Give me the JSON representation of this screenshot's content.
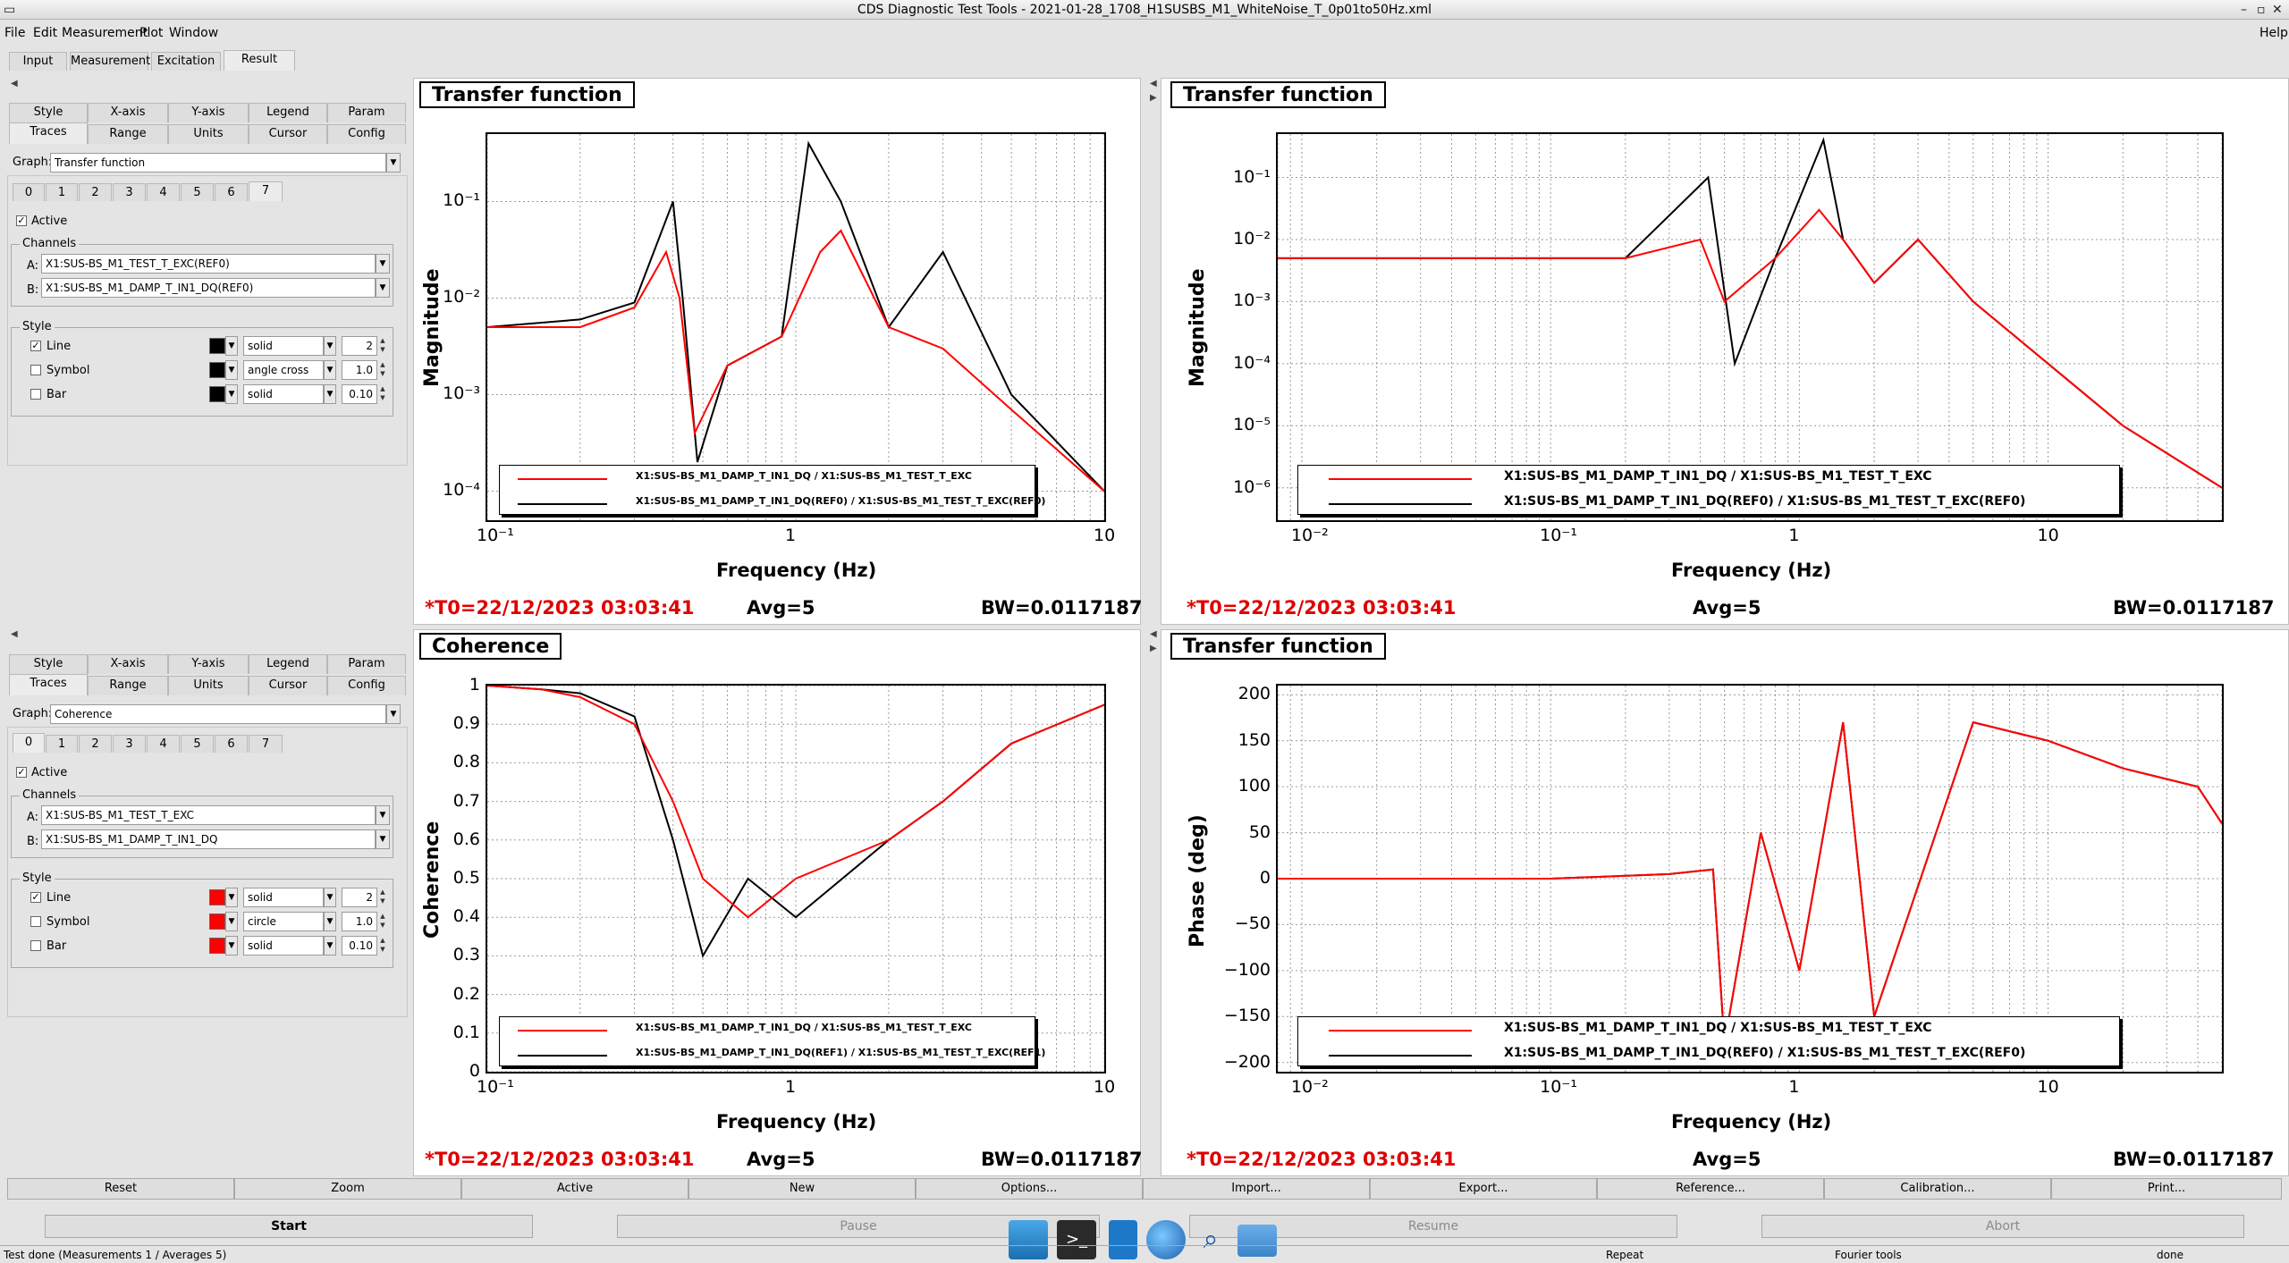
{
  "window": {
    "title": "CDS Diagnostic Test Tools - 2021-01-28_1708_H1SUSBS_M1_WhiteNoise_T_0p01to50Hz.xml"
  },
  "menu": {
    "items": [
      "File",
      "Edit",
      "Measurement",
      "Plot",
      "Window"
    ],
    "help": "Help"
  },
  "main_tabs": [
    "Input",
    "Measurement",
    "Excitation",
    "Result"
  ],
  "option_panels": [
    {
      "tabs_row1": [
        "Style",
        "X-axis",
        "Y-axis",
        "Legend",
        "Param"
      ],
      "tabs_row2": [
        "Traces",
        "Range",
        "Units",
        "Cursor",
        "Config"
      ],
      "graph_label": "Graph:",
      "graph_value": "Transfer function",
      "trace_tabs": [
        "0",
        "1",
        "2",
        "3",
        "4",
        "5",
        "6",
        "7"
      ],
      "active_label": "Active",
      "channels_title": "Channels",
      "channel_a_label": "A:",
      "channel_a": "X1:SUS-BS_M1_TEST_T_EXC(REF0)",
      "channel_b_label": "B:",
      "channel_b": "X1:SUS-BS_M1_DAMP_T_IN1_DQ(REF0)",
      "style_title": "Style",
      "line_label": "Line",
      "line_style": "solid",
      "line_width": "2",
      "symbol_label": "Symbol",
      "symbol_style": "angle cross",
      "symbol_size": "1.0",
      "bar_label": "Bar",
      "bar_style": "solid",
      "bar_width": "0.10",
      "color": "#000000"
    },
    {
      "tabs_row1": [
        "Style",
        "X-axis",
        "Y-axis",
        "Legend",
        "Param"
      ],
      "tabs_row2": [
        "Traces",
        "Range",
        "Units",
        "Cursor",
        "Config"
      ],
      "graph_label": "Graph:",
      "graph_value": "Coherence",
      "trace_tabs": [
        "0",
        "1",
        "2",
        "3",
        "4",
        "5",
        "6",
        "7"
      ],
      "active_label": "Active",
      "channels_title": "Channels",
      "channel_a_label": "A:",
      "channel_a": "X1:SUS-BS_M1_TEST_T_EXC",
      "channel_b_label": "B:",
      "channel_b": "X1:SUS-BS_M1_DAMP_T_IN1_DQ",
      "style_title": "Style",
      "line_label": "Line",
      "line_style": "solid",
      "line_width": "2",
      "symbol_label": "Symbol",
      "symbol_style": "circle",
      "symbol_size": "1.0",
      "bar_label": "Bar",
      "bar_style": "solid",
      "bar_width": "0.10",
      "color": "#ff0000"
    }
  ],
  "graphs": [
    {
      "title": "Transfer function",
      "ylabel": "Magnitude",
      "xlabel": "Frequency (Hz)",
      "x_ticks": [
        "10⁻¹",
        "1",
        "10"
      ],
      "y_ticks": [
        "10⁻¹",
        "10⁻²",
        "10⁻³",
        "10⁻⁴"
      ],
      "legend": [
        "X1:SUS-BS_M1_DAMP_T_IN1_DQ / X1:SUS-BS_M1_TEST_T_EXC",
        "X1:SUS-BS_M1_DAMP_T_IN1_DQ(REF0) / X1:SUS-BS_M1_TEST_T_EXC(REF0)"
      ],
      "t0": "*T0=22/12/2023 03:03:41",
      "avg": "Avg=5",
      "bw": "BW=0.0117187"
    },
    {
      "title": "Transfer function",
      "ylabel": "Magnitude",
      "xlabel": "Frequency (Hz)",
      "x_ticks": [
        "10⁻²",
        "10⁻¹",
        "1",
        "10"
      ],
      "y_ticks": [
        "10⁻¹",
        "10⁻²",
        "10⁻³",
        "10⁻⁴",
        "10⁻⁵",
        "10⁻⁶"
      ],
      "legend": [
        "X1:SUS-BS_M1_DAMP_T_IN1_DQ / X1:SUS-BS_M1_TEST_T_EXC",
        "X1:SUS-BS_M1_DAMP_T_IN1_DQ(REF0) / X1:SUS-BS_M1_TEST_T_EXC(REF0)"
      ],
      "t0": "*T0=22/12/2023 03:03:41",
      "avg": "Avg=5",
      "bw": "BW=0.0117187"
    },
    {
      "title": "Coherence",
      "ylabel": "Coherence",
      "xlabel": "Frequency (Hz)",
      "x_ticks": [
        "10⁻¹",
        "1",
        "10"
      ],
      "y_ticks": [
        "1",
        "0.9",
        "0.8",
        "0.7",
        "0.6",
        "0.5",
        "0.4",
        "0.3",
        "0.2",
        "0.1",
        "0"
      ],
      "legend": [
        "X1:SUS-BS_M1_DAMP_T_IN1_DQ / X1:SUS-BS_M1_TEST_T_EXC",
        "X1:SUS-BS_M1_DAMP_T_IN1_DQ(REF1) / X1:SUS-BS_M1_TEST_T_EXC(REF1)"
      ],
      "t0": "*T0=22/12/2023 03:03:41",
      "avg": "Avg=5",
      "bw": "BW=0.0117187"
    },
    {
      "title": "Transfer function",
      "ylabel": "Phase (deg)",
      "xlabel": "Frequency (Hz)",
      "x_ticks": [
        "10⁻²",
        "10⁻¹",
        "1",
        "10"
      ],
      "y_ticks": [
        "200",
        "150",
        "100",
        "50",
        "0",
        "−50",
        "−100",
        "−150",
        "−200"
      ],
      "legend": [
        "X1:SUS-BS_M1_DAMP_T_IN1_DQ / X1:SUS-BS_M1_TEST_T_EXC",
        "X1:SUS-BS_M1_DAMP_T_IN1_DQ(REF0) / X1:SUS-BS_M1_TEST_T_EXC(REF0)"
      ],
      "t0": "*T0=22/12/2023 03:03:41",
      "avg": "Avg=5",
      "bw": "BW=0.0117187"
    }
  ],
  "chart_data": [
    {
      "type": "line",
      "title": "Transfer function",
      "xlabel": "Frequency (Hz)",
      "ylabel": "Magnitude",
      "x_scale": "log",
      "y_scale": "log",
      "xlim": [
        0.1,
        10
      ],
      "ylim": [
        5e-05,
        0.5
      ],
      "grid": true,
      "legend_position": "bottom",
      "series": [
        {
          "name": "X1:SUS-BS_M1_DAMP_T_IN1_DQ / X1:SUS-BS_M1_TEST_T_EXC",
          "color": "#ff0000",
          "x": [
            0.1,
            0.2,
            0.3,
            0.38,
            0.42,
            0.47,
            0.6,
            0.9,
            1.2,
            1.4,
            2,
            3,
            5,
            10
          ],
          "y": [
            0.005,
            0.005,
            0.008,
            0.03,
            0.01,
            0.0004,
            0.002,
            0.004,
            0.03,
            0.05,
            0.005,
            0.003,
            0.0007,
            0.0001
          ]
        },
        {
          "name": "X1:SUS-BS_M1_DAMP_T_IN1_DQ(REF0) / X1:SUS-BS_M1_TEST_T_EXC(REF0)",
          "color": "#000000",
          "x": [
            0.1,
            0.2,
            0.3,
            0.4,
            0.43,
            0.48,
            0.6,
            0.9,
            1.1,
            1.4,
            2,
            3,
            5,
            10
          ],
          "y": [
            0.005,
            0.006,
            0.009,
            0.1,
            0.01,
            0.0002,
            0.002,
            0.004,
            0.4,
            0.1,
            0.005,
            0.03,
            0.001,
            0.0001
          ]
        }
      ]
    },
    {
      "type": "line",
      "title": "Transfer function",
      "xlabel": "Frequency (Hz)",
      "ylabel": "Magnitude",
      "x_scale": "log",
      "y_scale": "log",
      "xlim": [
        0.008,
        50
      ],
      "ylim": [
        3e-07,
        0.5
      ],
      "grid": true,
      "legend_position": "bottom",
      "series": [
        {
          "name": "X1:SUS-BS_M1_DAMP_T_IN1_DQ / X1:SUS-BS_M1_TEST_T_EXC",
          "color": "#ff0000",
          "x": [
            0.008,
            0.05,
            0.2,
            0.4,
            0.5,
            0.8,
            1.2,
            1.5,
            2,
            3,
            5,
            10,
            20,
            50
          ],
          "y": [
            0.005,
            0.005,
            0.005,
            0.01,
            0.001,
            0.005,
            0.03,
            0.01,
            0.002,
            0.01,
            0.001,
            0.0001,
            1e-05,
            1e-06
          ]
        },
        {
          "name": "X1:SUS-BS_M1_DAMP_T_IN1_DQ(REF0) / X1:SUS-BS_M1_TEST_T_EXC(REF0)",
          "color": "#000000",
          "x": [
            0.008,
            0.05,
            0.2,
            0.43,
            0.55,
            0.8,
            1.25,
            1.5,
            2,
            3,
            5,
            10,
            20,
            50
          ],
          "y": [
            0.005,
            0.005,
            0.005,
            0.1,
            0.0001,
            0.005,
            0.4,
            0.01,
            0.002,
            0.01,
            0.001,
            0.0001,
            1e-05,
            1e-06
          ]
        }
      ]
    },
    {
      "type": "line",
      "title": "Coherence",
      "xlabel": "Frequency (Hz)",
      "ylabel": "Coherence",
      "x_scale": "log",
      "y_scale": "linear",
      "xlim": [
        0.1,
        10
      ],
      "ylim": [
        0,
        1
      ],
      "grid": true,
      "legend_position": "bottom",
      "series": [
        {
          "name": "X1:SUS-BS_M1_DAMP_T_IN1_DQ / X1:SUS-BS_M1_TEST_T_EXC",
          "color": "#ff0000",
          "x": [
            0.1,
            0.15,
            0.2,
            0.3,
            0.4,
            0.5,
            0.7,
            1,
            2,
            3,
            5,
            10
          ],
          "y": [
            1.0,
            0.99,
            0.97,
            0.9,
            0.7,
            0.5,
            0.4,
            0.5,
            0.6,
            0.7,
            0.85,
            0.95
          ]
        },
        {
          "name": "X1:SUS-BS_M1_DAMP_T_IN1_DQ(REF1) / X1:SUS-BS_M1_TEST_T_EXC(REF1)",
          "color": "#000000",
          "x": [
            0.1,
            0.15,
            0.2,
            0.3,
            0.4,
            0.5,
            0.7,
            1,
            2,
            3,
            5,
            10
          ],
          "y": [
            1.0,
            0.99,
            0.98,
            0.92,
            0.6,
            0.3,
            0.5,
            0.4,
            0.6,
            0.7,
            0.85,
            0.95
          ]
        }
      ]
    },
    {
      "type": "line",
      "title": "Transfer function",
      "xlabel": "Frequency (Hz)",
      "ylabel": "Phase (deg)",
      "x_scale": "log",
      "y_scale": "linear",
      "xlim": [
        0.008,
        50
      ],
      "ylim": [
        -210,
        210
      ],
      "grid": true,
      "legend_position": "bottom",
      "series": [
        {
          "name": "X1:SUS-BS_M1_DAMP_T_IN1_DQ / X1:SUS-BS_M1_TEST_T_EXC",
          "color": "#ff0000",
          "x": [
            0.008,
            0.1,
            0.3,
            0.45,
            0.5,
            0.7,
            1,
            1.5,
            2,
            5,
            10,
            20,
            40,
            50
          ],
          "y": [
            0,
            0,
            5,
            10,
            -180,
            50,
            -100,
            170,
            -150,
            170,
            150,
            120,
            100,
            60
          ]
        },
        {
          "name": "X1:SUS-BS_M1_DAMP_T_IN1_DQ(REF0) / X1:SUS-BS_M1_TEST_T_EXC(REF0)",
          "color": "#000000",
          "x": [
            0.008,
            0.1,
            0.3,
            0.45,
            0.5,
            0.7,
            1,
            1.5,
            2,
            5,
            10,
            20,
            40,
            50
          ],
          "y": [
            0,
            0,
            5,
            10,
            -180,
            50,
            -100,
            170,
            -150,
            170,
            150,
            120,
            100,
            60
          ]
        }
      ]
    }
  ],
  "button_row": [
    "Reset",
    "Zoom",
    "Active",
    "New",
    "Options...",
    "Import...",
    "Export...",
    "Reference...",
    "Calibration...",
    "Print..."
  ],
  "control_buttons": [
    "Start",
    "Pause",
    "Resume",
    "Abort"
  ],
  "statusbar": {
    "message": "Test done (Measurements 1 / Averages 5)",
    "repeat": "Repeat",
    "fourier": "Fourier tools",
    "state": "done"
  }
}
